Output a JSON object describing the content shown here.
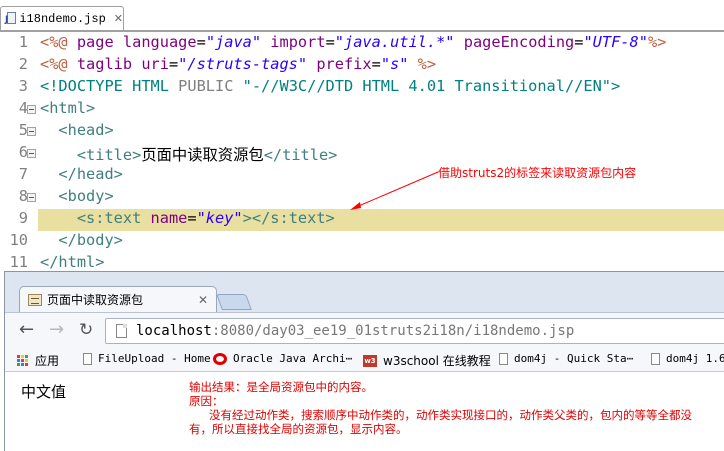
{
  "editor": {
    "tab_title": "i18ndemo.jsp",
    "tab_close": "✕",
    "lines": [
      {
        "n": "1",
        "fold": false,
        "parts": [
          {
            "c": "t-jsp",
            "t": "<%@ "
          },
          {
            "c": "t-attr",
            "t": "page "
          },
          {
            "c": "t-attr",
            "t": "language"
          },
          {
            "c": "t-black",
            "t": "="
          },
          {
            "c": "t-val",
            "t": "\"java\""
          },
          {
            "c": "t-black",
            "t": " "
          },
          {
            "c": "t-attr",
            "t": "import"
          },
          {
            "c": "t-black",
            "t": "="
          },
          {
            "c": "t-val",
            "t": "\"java.util.*\""
          },
          {
            "c": "t-black",
            "t": " "
          },
          {
            "c": "t-attr",
            "t": "pageEncoding"
          },
          {
            "c": "t-black",
            "t": "="
          },
          {
            "c": "t-val",
            "t": "\"UTF-8\""
          },
          {
            "c": "t-jsp",
            "t": "%>"
          }
        ]
      },
      {
        "n": "2",
        "fold": false,
        "parts": [
          {
            "c": "t-jsp",
            "t": "<%@ "
          },
          {
            "c": "t-attr",
            "t": "taglib "
          },
          {
            "c": "t-attr",
            "t": "uri"
          },
          {
            "c": "t-black",
            "t": "="
          },
          {
            "c": "t-val",
            "t": "\"/struts-tags\""
          },
          {
            "c": "t-black",
            "t": " "
          },
          {
            "c": "t-attr",
            "t": "prefix"
          },
          {
            "c": "t-black",
            "t": "="
          },
          {
            "c": "t-val",
            "t": "\"s\""
          },
          {
            "c": "t-black",
            "t": " "
          },
          {
            "c": "t-jsp",
            "t": "%>"
          }
        ]
      },
      {
        "n": "3",
        "fold": false,
        "parts": [
          {
            "c": "t-doc",
            "t": "<!DOCTYPE "
          },
          {
            "c": "t-doc",
            "t": "HTML "
          },
          {
            "c": "t-gray",
            "t": "PUBLIC "
          },
          {
            "c": "t-doc",
            "t": "\"-//W3C//DTD HTML 4.01 Transitional//EN\">"
          }
        ]
      },
      {
        "n": "4",
        "fold": true,
        "parts": [
          {
            "c": "t-tag",
            "t": "<html>"
          }
        ]
      },
      {
        "n": "5",
        "fold": true,
        "parts": [
          {
            "c": "t-black",
            "t": "  "
          },
          {
            "c": "t-tag",
            "t": "<head>"
          }
        ]
      },
      {
        "n": "6",
        "fold": true,
        "parts": [
          {
            "c": "t-black",
            "t": "    "
          },
          {
            "c": "t-tag",
            "t": "<title>"
          },
          {
            "c": "t-black",
            "t": "页面中读取资源包"
          },
          {
            "c": "t-tag",
            "t": "</title>"
          }
        ]
      },
      {
        "n": "7",
        "fold": false,
        "parts": [
          {
            "c": "t-black",
            "t": "  "
          },
          {
            "c": "t-tag",
            "t": "</head>"
          }
        ]
      },
      {
        "n": "8",
        "fold": true,
        "parts": [
          {
            "c": "t-black",
            "t": "  "
          },
          {
            "c": "t-tag",
            "t": "<body>"
          }
        ]
      },
      {
        "n": "9",
        "fold": false,
        "hl": true,
        "parts": [
          {
            "c": "t-black",
            "t": "    "
          },
          {
            "c": "t-tag",
            "t": "<s:text "
          },
          {
            "c": "t-attr",
            "t": "name"
          },
          {
            "c": "t-black",
            "t": "="
          },
          {
            "c": "t-val",
            "t": "\"key\""
          },
          {
            "c": "t-tag",
            "t": "></s:text>"
          }
        ]
      },
      {
        "n": "10",
        "fold": false,
        "parts": [
          {
            "c": "t-black",
            "t": "  "
          },
          {
            "c": "t-tag",
            "t": "</body>"
          }
        ]
      },
      {
        "n": "11",
        "fold": false,
        "parts": [
          {
            "c": "t-tag",
            "t": "</html>"
          }
        ]
      }
    ],
    "annotation": "借助struts2的标签来读取资源包内容",
    "annotation_color": "#ff0000"
  },
  "browser": {
    "tab_title": "页面中读取资源包",
    "tab_close": "✕",
    "nav": {
      "back": "←",
      "forward": "→",
      "reload": "↻"
    },
    "url_host": "localhost",
    "url_rest": ":8080/day03_ee19_01struts2i18n/i18ndemo.jsp",
    "bookmarks": [
      {
        "icon": "apps-icon",
        "label": "应用"
      },
      {
        "icon": "page-icon",
        "label": "FileUpload - Home"
      },
      {
        "icon": "oracle-icon",
        "label": "Oracle Java Archi⋯"
      },
      {
        "icon": "w3school-icon",
        "label": "w3school 在线教程"
      },
      {
        "icon": "page-icon",
        "label": "dom4j - Quick Sta⋯"
      },
      {
        "icon": "page-icon",
        "label": "dom4j 1.6."
      }
    ],
    "page_text": "中文值",
    "note_title": "输出结果：是全局资源包中的内容。",
    "note_reason_label": "原因：",
    "note_reason_line1": "没有经过动作类，搜索顺序中动作类的，动作类实现接口的，动作类父类的，包内的等等全都没",
    "note_reason_line2": "有，所以直接找全局的资源包，显示内容。",
    "note_color": "#e00000"
  }
}
